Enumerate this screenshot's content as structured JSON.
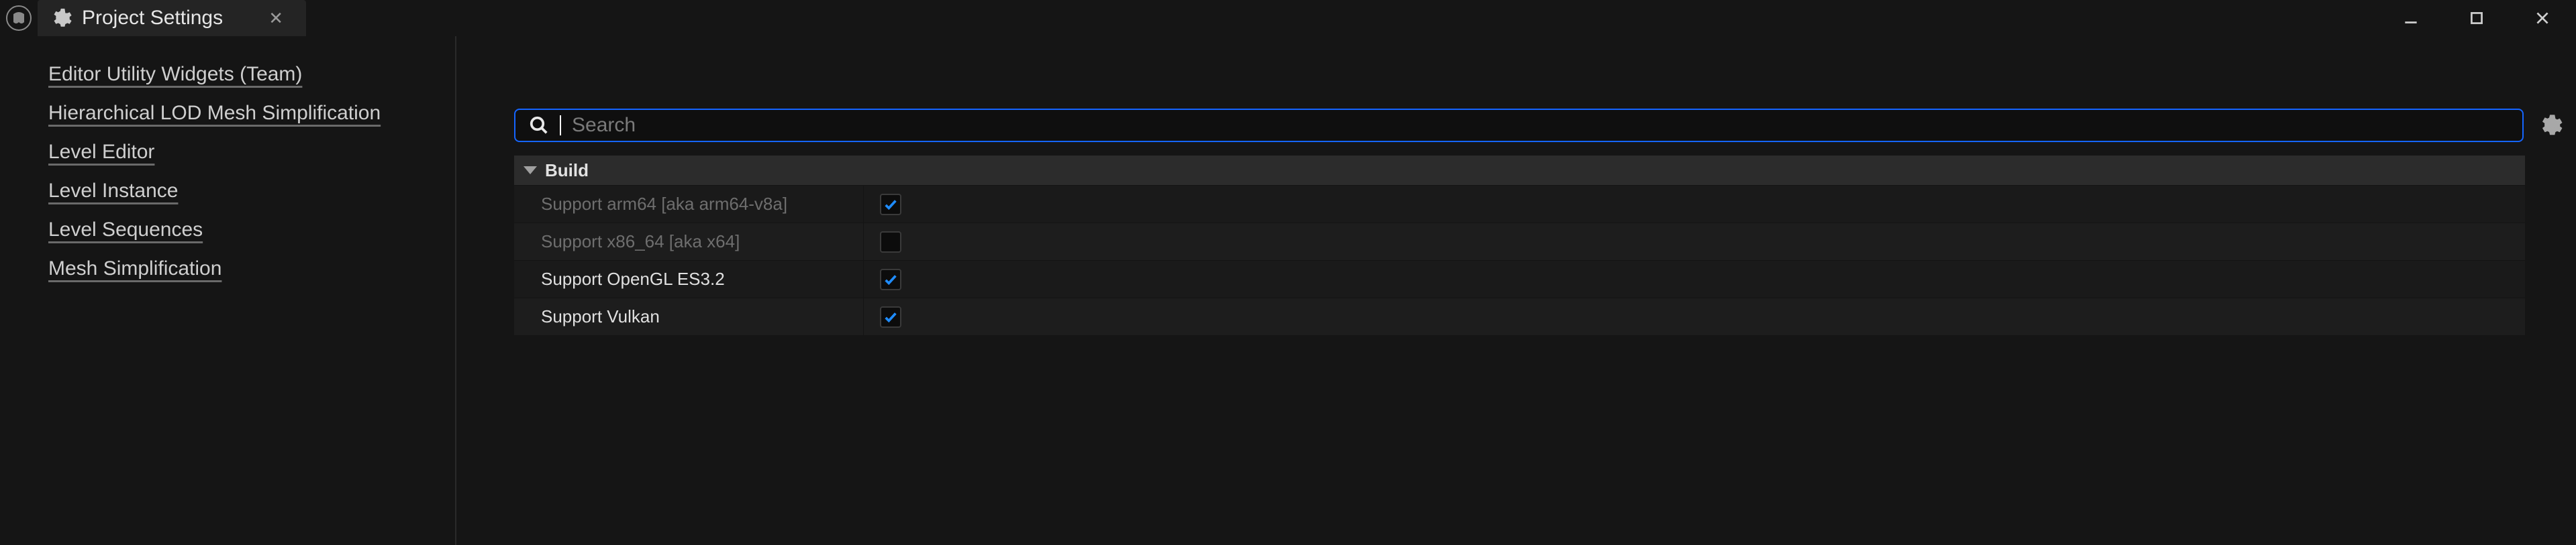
{
  "window": {
    "tab_title": "Project Settings"
  },
  "sidebar": {
    "items": [
      {
        "label": "Editor Utility Widgets (Team)"
      },
      {
        "label": "Hierarchical LOD Mesh Simplification"
      },
      {
        "label": "Level Editor"
      },
      {
        "label": "Level Instance"
      },
      {
        "label": "Level Sequences"
      },
      {
        "label": "Mesh Simplification"
      }
    ]
  },
  "search": {
    "placeholder": "Search",
    "value": ""
  },
  "group": {
    "title": "Build",
    "rows": [
      {
        "label": "Support arm64 [aka arm64-v8a]",
        "checked": true,
        "disabled": true
      },
      {
        "label": "Support x86_64 [aka x64]",
        "checked": false,
        "disabled": true
      },
      {
        "label": "Support OpenGL ES3.2",
        "checked": true,
        "disabled": false
      },
      {
        "label": "Support Vulkan",
        "checked": true,
        "disabled": false
      }
    ]
  },
  "icons": {
    "ue": "unreal-logo",
    "gear": "gear-icon",
    "close": "close-icon",
    "min": "minimize-icon",
    "max": "maximize-icon",
    "winclose": "window-close-icon",
    "search": "search-icon",
    "settings": "settings-gear-icon",
    "chevron": "chevron-down-icon",
    "check": "checkmark-icon"
  }
}
